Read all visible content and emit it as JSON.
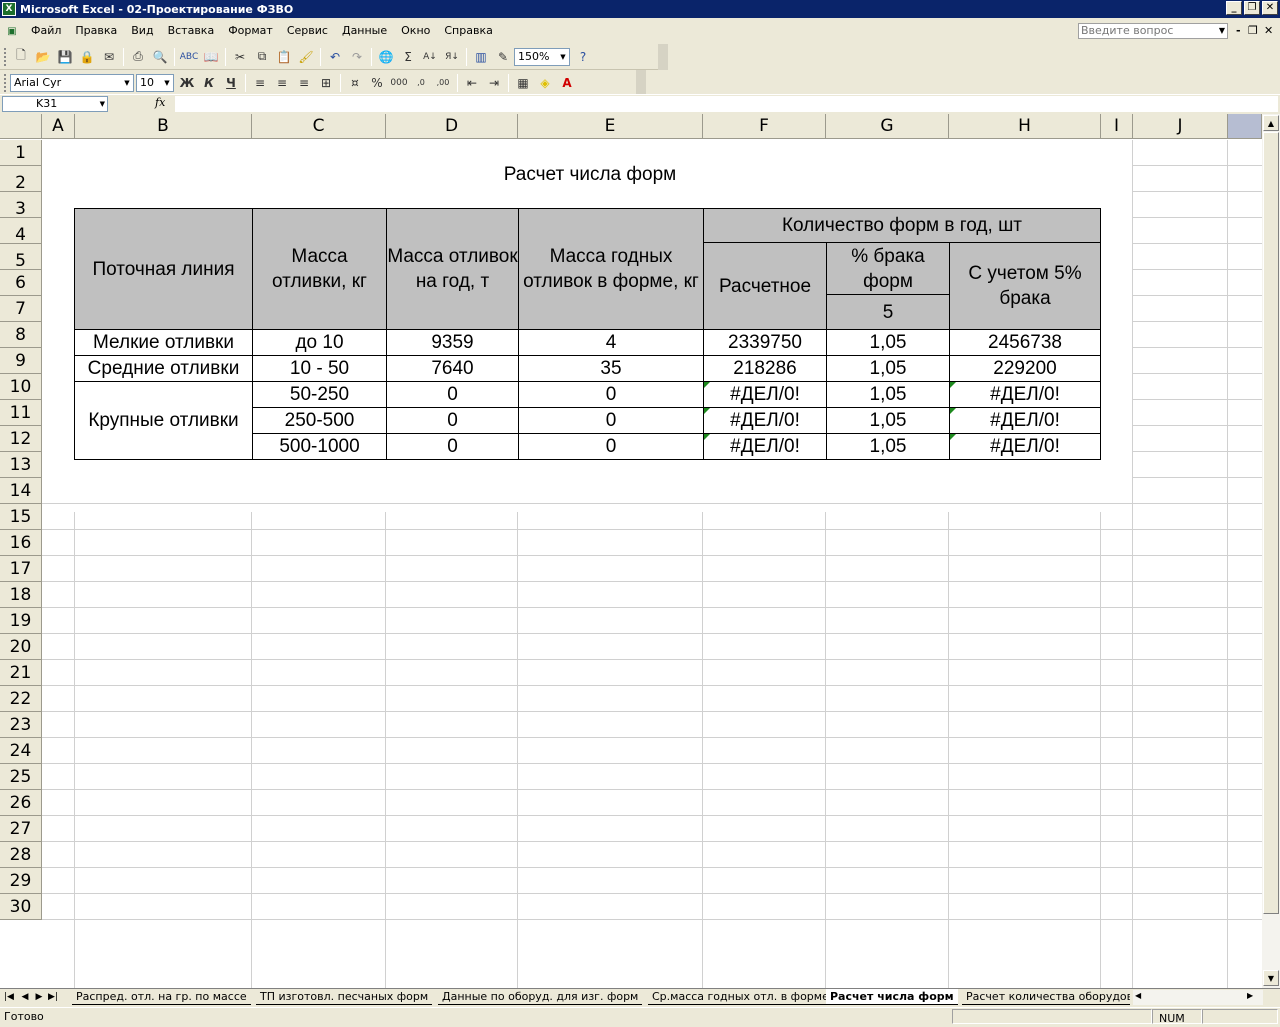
{
  "window": {
    "title": "Microsoft Excel - 02-Проектирование ФЗВО",
    "app_icon": "excel-icon"
  },
  "menu": [
    {
      "label": "Файл"
    },
    {
      "label": "Правка"
    },
    {
      "label": "Вид"
    },
    {
      "label": "Вставка"
    },
    {
      "label": "Формат"
    },
    {
      "label": "Сервис"
    },
    {
      "label": "Данные"
    },
    {
      "label": "Окно"
    },
    {
      "label": "Справка"
    }
  ],
  "help_box": {
    "placeholder": "Введите вопрос"
  },
  "toolbar": {
    "zoom": "150%",
    "font_name": "Arial Cyr",
    "font_size": "10",
    "bold": "Ж",
    "italic": "К",
    "underline": "Ч"
  },
  "formula_bar": {
    "name_box": "K31",
    "fx": "fx",
    "value": ""
  },
  "columns": [
    "A",
    "B",
    "C",
    "D",
    "E",
    "F",
    "G",
    "H",
    "I",
    "J"
  ],
  "rows": [
    "1",
    "2",
    "3",
    "4",
    "5",
    "6",
    "7",
    "8",
    "9",
    "10",
    "11",
    "12",
    "13",
    "14",
    "15",
    "16",
    "17",
    "18",
    "19",
    "20",
    "21",
    "22",
    "23",
    "24",
    "25",
    "26",
    "27",
    "28",
    "29",
    "30"
  ],
  "sheet": {
    "title": "Расчет числа форм",
    "headers": {
      "line": "Поточная линия",
      "mass_casting": "Масса отливки, кг",
      "mass_year": "Масса отливок на год, т",
      "mass_good": "Масса годных отливок в форме, кг",
      "forms_group": "Количество форм в год, шт",
      "calculated": "Расчетное",
      "defect": "% брака форм",
      "defect_value": "5",
      "with_defect": "С учетом 5% брака"
    },
    "rows": [
      {
        "line": "Мелкие отливки",
        "mass": "до 10",
        "year": "9359",
        "good": "4",
        "calc": "2339750",
        "k": "1,05",
        "total": "2456738"
      },
      {
        "line": "Средние отливки",
        "mass": "10 - 50",
        "year": "7640",
        "good": "35",
        "calc": "218286",
        "k": "1,05",
        "total": "229200"
      },
      {
        "line": "Крупные отливки",
        "mass": "50-250",
        "year": "0",
        "good": "0",
        "calc": "#ДЕЛ/0!",
        "k": "1,05",
        "total": "#ДЕЛ/0!"
      },
      {
        "line": "",
        "mass": "250-500",
        "year": "0",
        "good": "0",
        "calc": "#ДЕЛ/0!",
        "k": "1,05",
        "total": "#ДЕЛ/0!"
      },
      {
        "line": "",
        "mass": "500-1000",
        "year": "0",
        "good": "0",
        "calc": "#ДЕЛ/0!",
        "k": "1,05",
        "total": "#ДЕЛ/0!"
      }
    ]
  },
  "tabs": [
    {
      "label": "Распред. отл. на гр. по массе"
    },
    {
      "label": "ТП изготовл. песчаных форм"
    },
    {
      "label": "Данные по оборуд. для изг. форм"
    },
    {
      "label": "Ср.масса годных отл. в форме"
    },
    {
      "label": "Расчет числа форм"
    },
    {
      "label": "Расчет количества оборудован"
    }
  ],
  "status": {
    "ready": "Готово",
    "num": "NUM"
  }
}
